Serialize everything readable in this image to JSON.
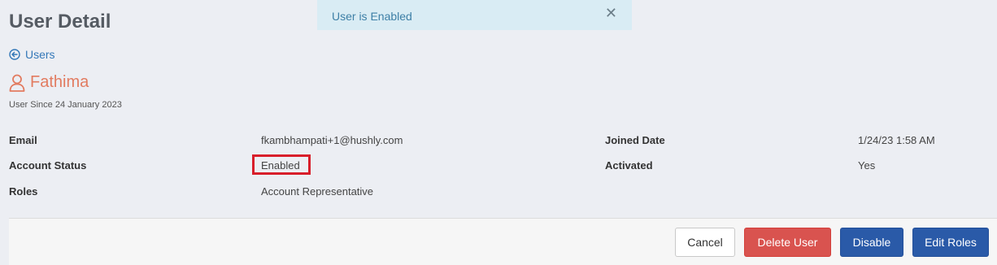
{
  "page": {
    "title": "User Detail"
  },
  "toast": {
    "message": "User is Enabled",
    "close_glyph": "✕"
  },
  "nav": {
    "back_label": "Users",
    "back_icon": "arrow-circle-left-icon"
  },
  "user": {
    "name": "Fathima",
    "icon": "user-icon",
    "since": "User Since 24 January 2023",
    "name_color": "#e27b60"
  },
  "details": {
    "email_label": "Email",
    "email_value": "fkambhampati+1@hushly.com",
    "status_label": "Account Status",
    "status_value": "Enabled",
    "roles_label": "Roles",
    "roles_value": "Account Representative",
    "joined_label": "Joined Date",
    "joined_value": "1/24/23 1:58 AM",
    "activated_label": "Activated",
    "activated_value": "Yes"
  },
  "actions": {
    "cancel": "Cancel",
    "delete": "Delete User",
    "disable": "Disable",
    "edit_roles": "Edit Roles"
  },
  "colors": {
    "primary": "#2a5aa8",
    "danger": "#d9534f",
    "highlight_border": "#d81e2a"
  }
}
